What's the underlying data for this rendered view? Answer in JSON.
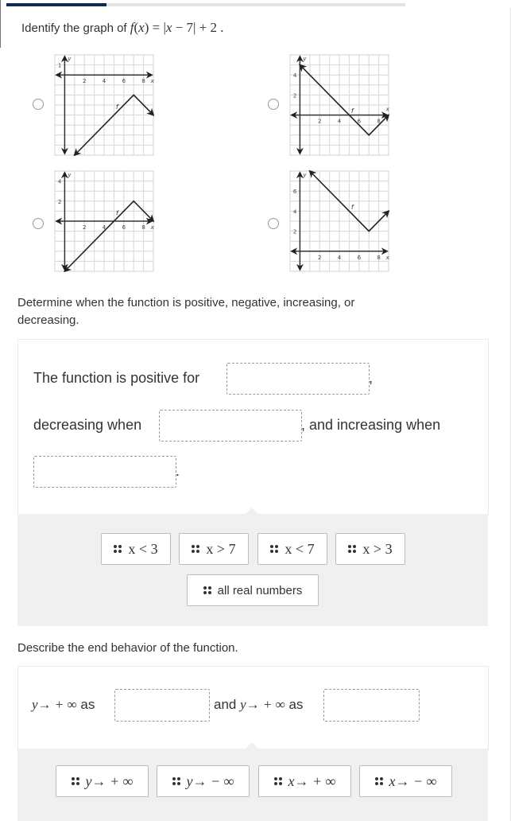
{
  "progress": {
    "fraction": 0.25
  },
  "question": {
    "prefix": "Identify the graph of ",
    "function_latex": "f(x) = |x − 7| + 2",
    "f": "f",
    "lp": "(",
    "x": "x",
    "rp": ")",
    "eq": " = |",
    "x2": "x",
    "rest": " − 7| + 2 .",
    "suffix": ""
  },
  "graph_options": [
    {
      "id": "A",
      "function_label": "f",
      "x_ticks": [
        "2",
        "4",
        "6",
        "8"
      ],
      "y_ticks": [
        "1"
      ],
      "x_axis_label": "x",
      "y_axis_label": "y",
      "vertex": [
        7,
        -2
      ],
      "description": "inverted V, vertex (7,-2), opens downward",
      "x_range": [
        -1,
        9
      ],
      "y_range": [
        -8,
        2
      ]
    },
    {
      "id": "B",
      "function_label": "f",
      "x_ticks": [
        "2",
        "4",
        "6",
        "8"
      ],
      "y_ticks": [
        "2",
        "4"
      ],
      "x_axis_label": "x",
      "y_axis_label": "y",
      "vertex": [
        7,
        -2
      ],
      "description": "V, vertex (7,-2), opens upward",
      "x_range": [
        -1,
        9
      ],
      "y_range": [
        -4,
        6
      ]
    },
    {
      "id": "C",
      "function_label": "f",
      "x_ticks": [
        "2",
        "4",
        "6",
        "8"
      ],
      "y_ticks": [
        "2",
        "4"
      ],
      "x_axis_label": "x",
      "y_axis_label": "y",
      "vertex": [
        7,
        2
      ],
      "description": "inverted V, vertex (7,2), opens downward",
      "x_range": [
        -1,
        9
      ],
      "y_range": [
        -5,
        5
      ]
    },
    {
      "id": "D",
      "function_label": "f",
      "x_ticks": [
        "2",
        "4",
        "6",
        "8"
      ],
      "y_ticks": [
        "2",
        "4",
        "6"
      ],
      "x_axis_label": "x",
      "y_axis_label": "y",
      "vertex": [
        7,
        2
      ],
      "description": "V, vertex (7,2), opens upward",
      "x_range": [
        -1,
        9
      ],
      "y_range": [
        -2,
        8
      ]
    }
  ],
  "section2": {
    "prompt": "Determine when the function is positive, negative, increasing, or decreasing.",
    "line1_text": "The function is positive for",
    "line1_after": ",",
    "line2_text": "decreasing when",
    "line2_after": ", and increasing when",
    "line3_after": ".",
    "choices": [
      "x < 3",
      "x > 7",
      "x < 7",
      "x > 3",
      "all real numbers"
    ]
  },
  "section3": {
    "prompt": "Describe the end behavior of the function.",
    "part1_math": "y→ + ∞",
    "part1_as": " as",
    "part2_and": "and ",
    "part2_math": "y→ + ∞",
    "part2_as": " as",
    "choices": [
      "y→ + ∞",
      "y→ − ∞",
      "x→ + ∞",
      "x→ − ∞"
    ]
  },
  "colors": {
    "progress_fill": "#0f2a52",
    "progress_track": "#e3e3e3",
    "tray_bg": "#f0f0f0",
    "text": "#333333"
  }
}
